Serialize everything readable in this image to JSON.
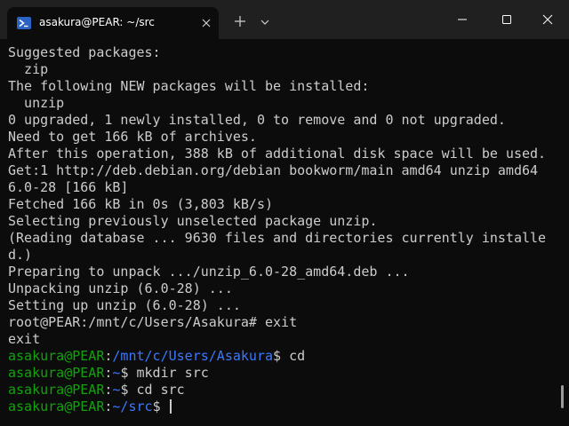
{
  "window": {
    "tab_title": "asakura@PEAR: ~/src",
    "tab_icon": "terminal-powershell-icon",
    "controls": [
      "new-tab-icon",
      "dropdown-chevron-icon",
      "minimize-icon",
      "maximize-icon",
      "close-icon"
    ]
  },
  "colors": {
    "background": "#0c0c0c",
    "titlebar": "#202020",
    "text": "#cccccc",
    "user": "#13a10e",
    "path": "#3b78ff"
  },
  "terminal": {
    "output": [
      "Suggested packages:",
      "  zip",
      "The following NEW packages will be installed:",
      "  unzip",
      "0 upgraded, 1 newly installed, 0 to remove and 0 not upgraded.",
      "Need to get 166 kB of archives.",
      "After this operation, 388 kB of additional disk space will be used.",
      "Get:1 http://deb.debian.org/debian bookworm/main amd64 unzip amd64",
      "6.0-28 [166 kB]",
      "Fetched 166 kB in 0s (3,803 kB/s)",
      "Selecting previously unselected package unzip.",
      "(Reading database ... 9630 files and directories currently installe",
      "d.)",
      "Preparing to unpack .../unzip_6.0-28_amd64.deb ...",
      "Unpacking unzip (6.0-28) ...",
      "Setting up unzip (6.0-28) ...",
      "root@PEAR:/mnt/c/Users/Asakura# exit",
      "exit"
    ],
    "prompts": [
      {
        "user": "asakura@PEAR",
        "sep": ":",
        "path": "/mnt/c/Users/Asakura",
        "sym": "$",
        "cmd": " cd"
      },
      {
        "user": "asakura@PEAR",
        "sep": ":",
        "path": "~",
        "sym": "$",
        "cmd": " mkdir src"
      },
      {
        "user": "asakura@PEAR",
        "sep": ":",
        "path": "~",
        "sym": "$",
        "cmd": " cd src"
      },
      {
        "user": "asakura@PEAR",
        "sep": ":",
        "path": "~/src",
        "sym": "$",
        "cmd": " "
      }
    ]
  }
}
